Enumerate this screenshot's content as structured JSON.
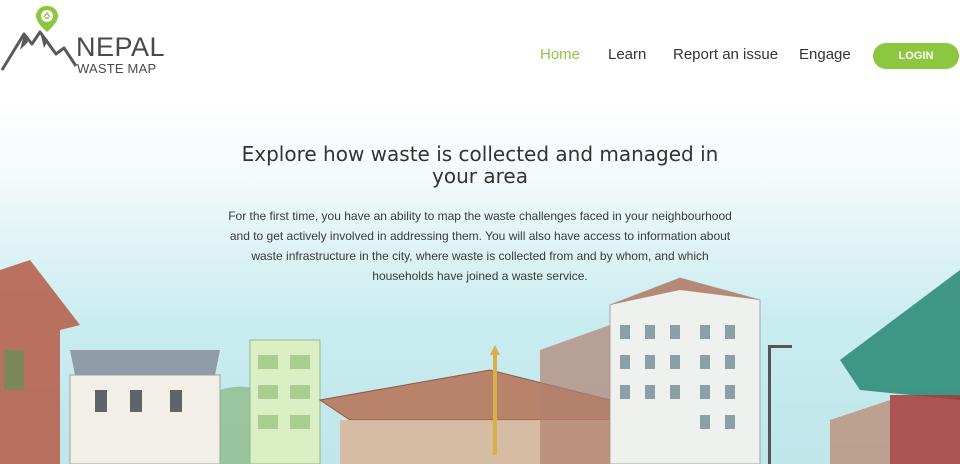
{
  "logo": {
    "line1": "NEPAL",
    "line2": "WASTE MAP",
    "icon": "recycle-pin-icon"
  },
  "nav": {
    "items": [
      {
        "label": "Home",
        "active": true
      },
      {
        "label": "Learn",
        "active": false
      },
      {
        "label": "Report an issue",
        "active": false
      },
      {
        "label": "Engage",
        "active": false
      }
    ],
    "login_label": "LOGIN"
  },
  "hero": {
    "title": "Explore how waste is collected and managed in your area",
    "description": "For the first time, you have an ability to map the waste challenges faced in your neighbourhood and to get actively involved in addressing them. You will also have access to information about waste infrastructure in the city, where waste is collected from and by whom, and which households have joined a waste service."
  },
  "colors": {
    "accent": "#8dc63f",
    "text": "#333333",
    "sky": "#c9ecf0"
  }
}
